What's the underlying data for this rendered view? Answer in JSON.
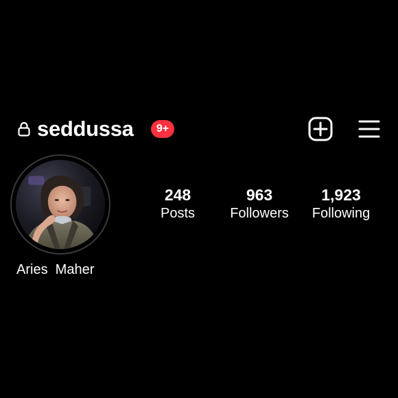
{
  "header": {
    "username": "seddussa",
    "notification_badge": "9+",
    "badge_color": "#ff3040",
    "icons": {
      "lock": "lock-icon",
      "add": "add-square-icon",
      "menu": "hamburger-menu-icon"
    }
  },
  "profile": {
    "display_name": "Aries  Maher",
    "avatar": "profile-photo"
  },
  "stats": {
    "posts": {
      "value": "248",
      "label": "Posts"
    },
    "followers": {
      "value": "963",
      "label": "Followers"
    },
    "following": {
      "value": "1,923",
      "label": "Following"
    }
  },
  "theme": {
    "background": "#000000",
    "text": "#ffffff"
  }
}
